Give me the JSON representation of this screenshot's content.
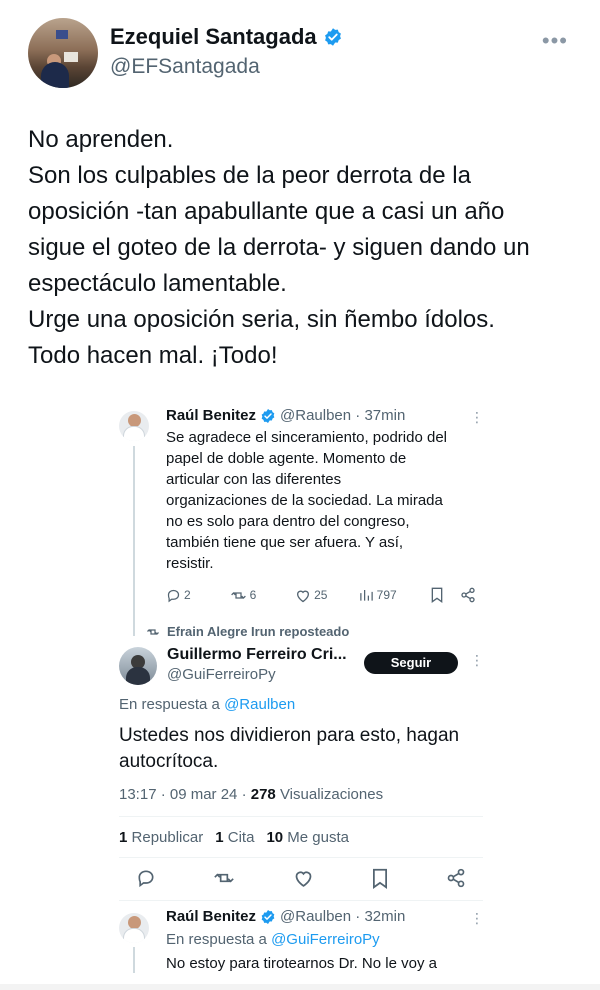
{
  "outer_tweet": {
    "name": "Ezequiel Santagada",
    "handle": "@EFSantagada",
    "lines": [
      "No aprenden.",
      "Son los culpables de la peor derrota de la",
      "oposición -tan apabullante que a casi un año",
      "sigue el goteo de la derrota- y siguen dando un",
      "espectáculo lamentable.",
      "Urge una oposición seria, sin ñembo ídolos.",
      "Todo hacen mal. ¡Todo!"
    ]
  },
  "quoted_tweet": {
    "name": "Raúl Benitez",
    "handle_time": "@Raulben · 37min",
    "lines": [
      "Se agradece el sinceramiento, podrido del",
      "papel de doble agente. Momento de",
      "articular con las diferentes",
      "organizaciones de la sociedad. La mirada",
      "no es solo para dentro del congreso,",
      "también tiene que ser afuera.  Y así,",
      "resistir."
    ],
    "replies": "2",
    "retweets": "6",
    "likes": "25",
    "views": "797"
  },
  "reposted": {
    "label": "Efrain Alegre Irun reposteado",
    "name": "Guillermo Ferreiro Cri...",
    "handle": "@GuiFerreiroPy",
    "follow_label": "Seguir",
    "reply_prefix": "En respuesta a",
    "reply_to": "@Raulben",
    "text_lines": [
      "Ustedes nos dividieron para esto, hagan",
      "autocrítoca."
    ],
    "time": "13:17 · 09 mar 24 ·",
    "views_count": "278",
    "views_label": "Visualizaciones",
    "stats": {
      "republish_count": "1",
      "republish_label": "Republicar",
      "quote_count": "1",
      "quote_label": "Cita",
      "likes_count": "10",
      "likes_label": "Me gusta"
    }
  },
  "reply_tweet": {
    "name": "Raúl Benitez",
    "handle_time": "@Raulben · 32min",
    "reply_prefix": "En respuesta a",
    "reply_to": "@GuiFerreiroPy",
    "text": "No estoy para tirotearnos Dr. No le voy a"
  },
  "colors": {
    "accent": "#1d9bf0",
    "text": "#0f1419",
    "muted": "#536471"
  }
}
